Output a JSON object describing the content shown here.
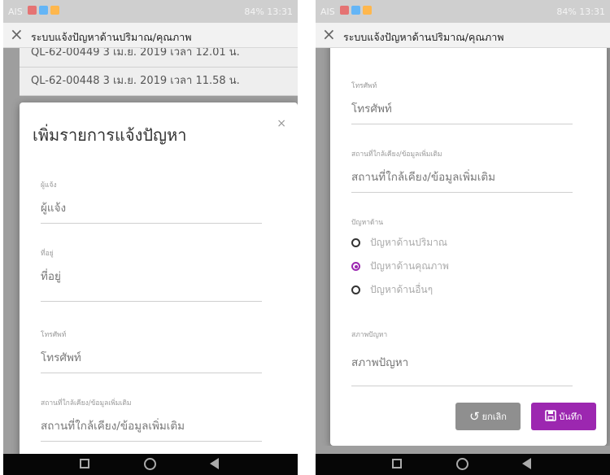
{
  "status_bar": {
    "carrier": "AIS",
    "right": "84% 13:31",
    "icon_colors": [
      "#e57373",
      "#64b5f6",
      "#ffb74d"
    ]
  },
  "app_bar": {
    "close_icon": "×",
    "title": "ระบบแจ้งปัญหาด้านปริมาณ/คุณภาพ"
  },
  "background_list": [
    {
      "text": "QL-62-00449   3 เม.ย. 2019 เวลา 12.01 น."
    },
    {
      "text": "QL-62-00448   3 เม.ย. 2019 เวลา 11.58 น."
    }
  ],
  "modal": {
    "title": "เพิ่มรายการแจ้งปัญหา",
    "close": "×"
  },
  "form_left": [
    {
      "label": "ผู้แจ้ง",
      "placeholder": "ผู้แจ้ง"
    },
    {
      "label": "ที่อยู่",
      "placeholder": "ที่อยู่"
    },
    {
      "label": "โทรศัพท์",
      "placeholder": "โทรศัพท์"
    },
    {
      "label": "สถานที่ใกล้เคียง/ข้อมูลเพิ่มเติม",
      "placeholder": "สถานที่ใกล้เคียง/ข้อมูลเพิ่มเติม"
    }
  ],
  "form_right": {
    "phone": {
      "label": "โทรศัพท์",
      "placeholder": "โทรศัพท์"
    },
    "nearby": {
      "label": "สถานที่ใกล้เคียง/ข้อมูลเพิ่มเติม",
      "placeholder": "สถานที่ใกล้เคียง/ข้อมูลเพิ่มเติม"
    },
    "problem_label": "ปัญหาด้าน",
    "options": [
      {
        "label": "ปัญหาด้านปริมาณ",
        "selected": false
      },
      {
        "label": "ปัญหาด้านคุณภาพ",
        "selected": true
      },
      {
        "label": "ปัญหาด้านอื่นๆ",
        "selected": false
      }
    ],
    "condition": {
      "label": "สภาพปัญหา",
      "placeholder": "สภาพปัญหา"
    }
  },
  "buttons": {
    "cancel": "ยกเลิก",
    "cancel_icon": "undo-icon",
    "save": "บันทึก",
    "save_icon": "floppy-disk-icon"
  },
  "accent_color": "#9c27b0"
}
